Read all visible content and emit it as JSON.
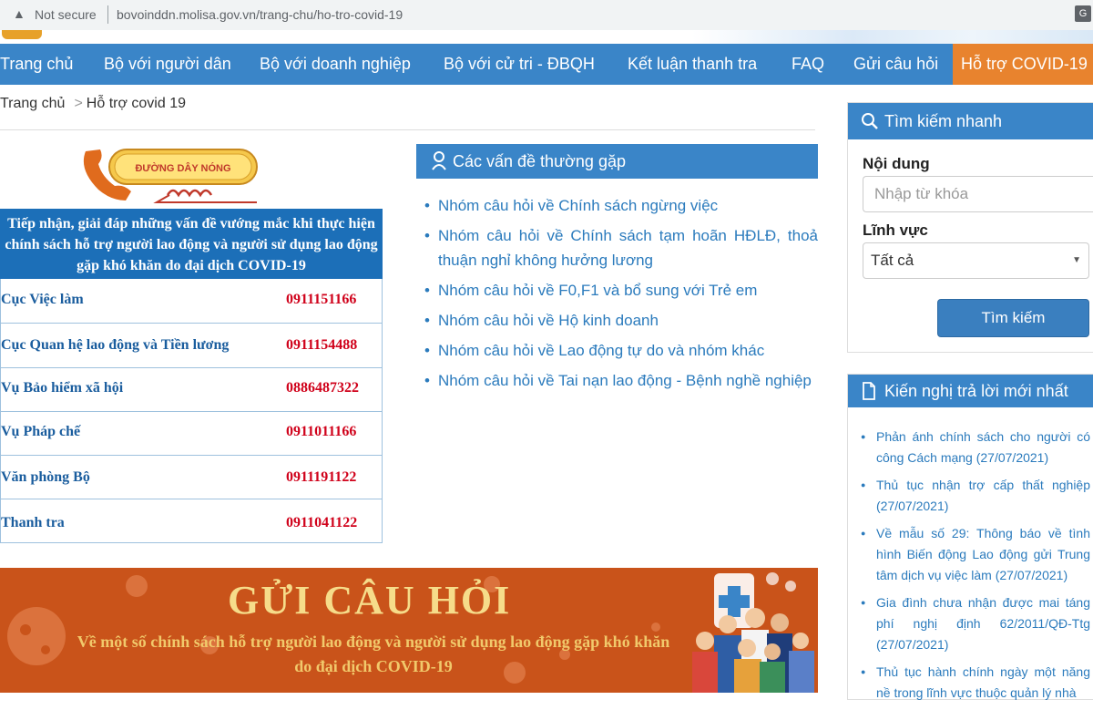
{
  "browser": {
    "security": "Not secure",
    "url": "bovoinddn.molisa.gov.vn/trang-chu/ho-tro-covid-19"
  },
  "nav": {
    "items": [
      "Trang chủ",
      "Bộ với người dân",
      "Bộ với doanh nghiệp",
      "Bộ với cử tri - ĐBQH",
      "Kết luận thanh tra",
      "FAQ",
      "Gửi câu hỏi",
      "Hỗ trợ COVID-19"
    ],
    "active_color": "#e8832e",
    "bar_color": "#3a85c8"
  },
  "breadcrumb": {
    "home": "Trang chủ",
    "current": "Hỗ trợ covid 19"
  },
  "hotline": {
    "logo_text": "ĐƯỜNG DÂY NÓNG",
    "title": "Tiếp nhận, giải đáp những vấn đề vướng mắc khi thực hiện chính sách hỗ trợ người lao động và người sử dụng lao động gặp khó khăn do đại dịch COVID-19",
    "rows": [
      {
        "name": "Cục Việc làm",
        "phone": "0911151166"
      },
      {
        "name": "Cục Quan hệ lao động và Tiền lương",
        "phone": "0911154488"
      },
      {
        "name": "Vụ Bảo hiểm xã hội",
        "phone": "0886487322"
      },
      {
        "name": "Vụ Pháp chế",
        "phone": "0911011166"
      },
      {
        "name": "Văn phòng Bộ",
        "phone": "0911191122"
      },
      {
        "name": "Thanh tra",
        "phone": "0911041122"
      }
    ]
  },
  "faq": {
    "title": "Các vấn đề thường gặp",
    "items": [
      "Nhóm câu hỏi về Chính sách ngừng việc",
      "Nhóm câu hỏi về Chính sách tạm hoãn HĐLĐ, thoả thuận nghỉ không hưởng lương",
      "Nhóm câu hỏi về F0,F1 và bổ sung với Trẻ em",
      "Nhóm câu hỏi về Hộ kinh doanh",
      "Nhóm câu hỏi về Lao động tự do và nhóm khác",
      "Nhóm câu hỏi về Tai nạn lao động - Bệnh nghề nghiệp"
    ]
  },
  "banner": {
    "title": "GỬI CÂU HỎI",
    "subtitle": "Về một số chính sách hỗ trợ người lao động và người sử dụng lao động gặp khó khăn do đại dịch COVID-19"
  },
  "search": {
    "title": "Tìm kiếm nhanh",
    "content_label": "Nội dung",
    "keyword_placeholder": "Nhập từ khóa",
    "field_label": "Lĩnh vực",
    "field_value": "Tất cả",
    "button": "Tìm kiếm"
  },
  "latest": {
    "title": "Kiến nghị trả lời mới nhất",
    "items": [
      "Phản ánh chính sách cho người có công Cách mạng (27/07/2021)",
      "Thủ tục nhận trợ cấp thất nghiệp (27/07/2021)",
      "Về mẫu số 29: Thông báo về tình hình Biến động Lao động gửi Trung tâm dịch vụ việc làm (27/07/2021)",
      "Gia đình chưa nhận được mai táng phí nghị định 62/2011/QĐ-Ttg (27/07/2021)",
      "Thủ tục hành chính ngày một năng nề trong lĩnh vực thuộc quản lý nhà"
    ]
  }
}
